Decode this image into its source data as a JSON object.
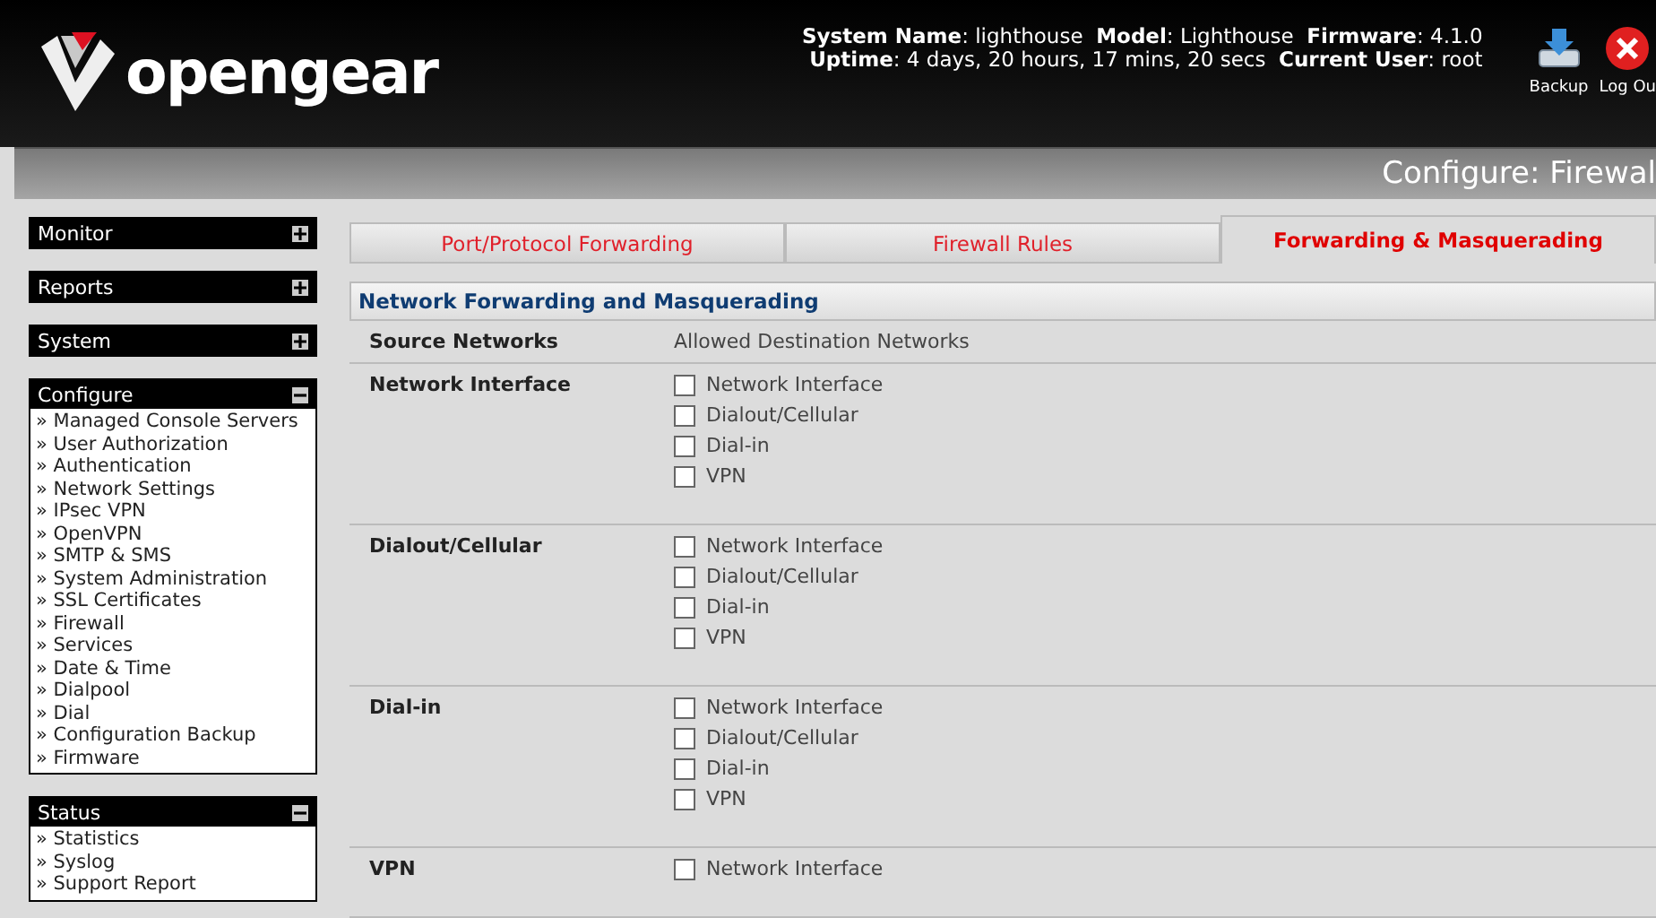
{
  "header": {
    "logo": "opengear",
    "info_lines": [
      "**System Name**: lighthouse  **Model**: Lighthouse  **Firmware**: 4.1.0",
      "**Uptime**: 4 days, 20 hours, 17 mins, 20 secs  **Current User**: root"
    ],
    "actions": [
      {
        "kind": "backup",
        "label": "Backup"
      },
      {
        "kind": "logout",
        "label": "Log Ou"
      }
    ]
  },
  "page_title": "Configure: Firewal",
  "sidebar": [
    {
      "title": "Monitor",
      "expanded": false
    },
    {
      "title": "Reports",
      "expanded": false
    },
    {
      "title": "System",
      "expanded": false
    },
    {
      "title": "Configure",
      "expanded": true,
      "items": [
        "» Managed Console Servers",
        "» User Authorization",
        "» Authentication",
        "» Network Settings",
        "» IPsec VPN",
        "» OpenVPN",
        "» SMTP & SMS",
        "» System Administration",
        "» SSL Certificates",
        "» Firewall",
        "» Services",
        "» Date & Time",
        "» Dialpool",
        "» Dial",
        "» Configuration Backup",
        "» Firmware"
      ]
    },
    {
      "title": "Status",
      "expanded": true,
      "items": [
        "» Statistics",
        "» Syslog",
        "» Support Report"
      ]
    }
  ],
  "tabs": [
    {
      "label": "Port/Protocol Forwarding",
      "selected": false
    },
    {
      "label": "Firewall Rules",
      "selected": false
    },
    {
      "label": "Forwarding & Masquerading",
      "selected": true
    }
  ],
  "section_title": "Network Forwarding and Masquerading",
  "columns": [
    "Source Networks",
    "Allowed Destination Networks"
  ],
  "rows": [
    {
      "source": "Network Interface",
      "options": [
        {
          "label": "Network Interface",
          "checked": false
        },
        {
          "label": "Dialout/Cellular",
          "checked": false
        },
        {
          "label": "Dial-in",
          "checked": false
        },
        {
          "label": "VPN",
          "checked": false
        }
      ]
    },
    {
      "source": "Dialout/Cellular",
      "options": [
        {
          "label": "Network Interface",
          "checked": false
        },
        {
          "label": "Dialout/Cellular",
          "checked": false
        },
        {
          "label": "Dial-in",
          "checked": false
        },
        {
          "label": "VPN",
          "checked": false
        }
      ]
    },
    {
      "source": "Dial-in",
      "options": [
        {
          "label": "Network Interface",
          "checked": false
        },
        {
          "label": "Dialout/Cellular",
          "checked": false
        },
        {
          "label": "Dial-in",
          "checked": false
        },
        {
          "label": "VPN",
          "checked": false
        }
      ]
    },
    {
      "source": "VPN",
      "options": [
        {
          "label": "Network Interface",
          "checked": false
        }
      ]
    }
  ]
}
